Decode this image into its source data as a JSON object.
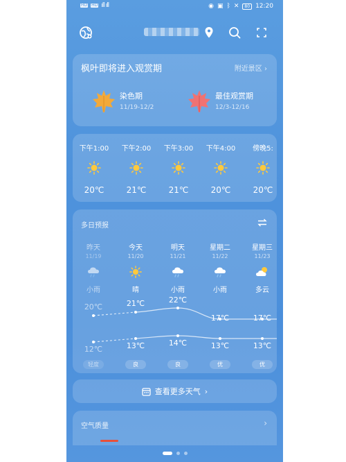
{
  "status_bar": {
    "sim1": "HD",
    "sim2": "HD",
    "bars": "ıll ıll",
    "battery": "80",
    "time": "12:20"
  },
  "maple": {
    "title": "枫叶即将进入观赏期",
    "link": "附近景区 ›",
    "stages": [
      {
        "name": "染色期",
        "date": "11/19-12/2",
        "color": "#f2a93b"
      },
      {
        "name": "最佳观赏期",
        "date": "12/3-12/16",
        "color": "#f06c6c"
      }
    ]
  },
  "hourly": [
    {
      "time": "下午1:00",
      "icon": "sun-icon",
      "temp": "20℃"
    },
    {
      "time": "下午2:00",
      "icon": "sun-icon",
      "temp": "21℃"
    },
    {
      "time": "下午3:00",
      "icon": "sun-icon",
      "temp": "21℃"
    },
    {
      "time": "下午4:00",
      "icon": "sun-icon",
      "temp": "20℃"
    },
    {
      "time": "傍晚5:",
      "icon": "sun-icon",
      "temp": "20℃"
    }
  ],
  "daily": {
    "title": "多日预报",
    "days": [
      {
        "day": "昨天",
        "date": "11/19",
        "icon": "rain-icon",
        "weather": "小雨",
        "high": "20℃",
        "low": "12℃",
        "aqi": "轻度",
        "past": true
      },
      {
        "day": "今天",
        "date": "11/20",
        "icon": "sun-icon",
        "weather": "晴",
        "high": "21℃",
        "low": "13℃",
        "aqi": "良",
        "past": false
      },
      {
        "day": "明天",
        "date": "11/21",
        "icon": "rain-icon",
        "weather": "小雨",
        "high": "22℃",
        "low": "14℃",
        "aqi": "良",
        "past": false
      },
      {
        "day": "星期二",
        "date": "11/22",
        "icon": "rain-icon",
        "weather": "小雨",
        "high": "17℃",
        "low": "13℃",
        "aqi": "优",
        "past": false
      },
      {
        "day": "星期三",
        "date": "11/23",
        "icon": "partly-cloudy-icon",
        "weather": "多云",
        "high": "17℃",
        "low": "13℃",
        "aqi": "优",
        "past": false
      }
    ]
  },
  "more_button": {
    "label": "查看更多天气",
    "chevron": "›"
  },
  "aqi_section": {
    "title": "空气质量",
    "chevron": "›"
  },
  "pager": {
    "count": 3,
    "active": 0
  }
}
